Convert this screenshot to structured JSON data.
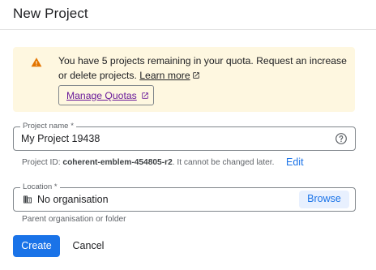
{
  "header": {
    "title": "New Project"
  },
  "quota_banner": {
    "message": "You have 5 projects remaining in your quota. Request an increase or delete projects.",
    "learn_more_label": "Learn more",
    "manage_quotas_label": "Manage Quotas",
    "warning_icon": "warning-icon",
    "link_icon": "open-in-new-icon",
    "background_color": "#fef7e0",
    "warning_color": "#e37400"
  },
  "project_name": {
    "label": "Project name *",
    "value": "My Project 19438",
    "help_icon": "help-circle-icon"
  },
  "project_id": {
    "prefix": "Project ID:",
    "id": "coherent-emblem-454805-r2",
    "suffix": ". It cannot be changed later.",
    "edit_label": "Edit"
  },
  "location": {
    "label": "Location *",
    "value": "No organisation",
    "icon": "building-icon",
    "browse_label": "Browse",
    "hint": "Parent organisation or folder"
  },
  "actions": {
    "create_label": "Create",
    "cancel_label": "Cancel",
    "primary_color": "#1a73e8"
  }
}
